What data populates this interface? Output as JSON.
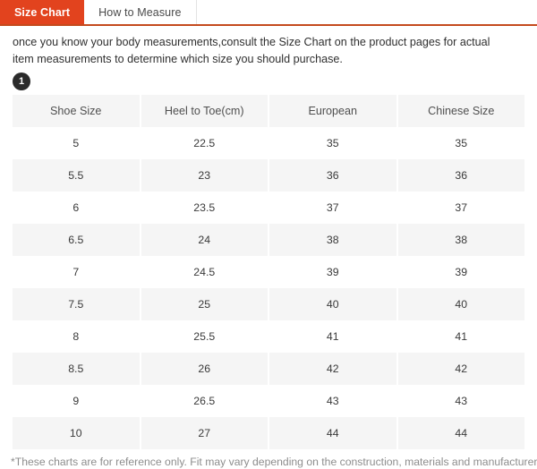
{
  "tabs": [
    {
      "label": "Size Chart",
      "active": true
    },
    {
      "label": "How to Measure",
      "active": false
    }
  ],
  "intro": {
    "text": "once you know your body measurements,consult the Size Chart on the product pages for actual item measurements to determine which size you should purchase.",
    "badge": "1"
  },
  "chart_data": {
    "type": "table",
    "title": "Size Chart",
    "columns": [
      "Shoe Size",
      "Heel to Toe(cm)",
      "European",
      "Chinese Size"
    ],
    "rows": [
      [
        "5",
        "22.5",
        "35",
        "35"
      ],
      [
        "5.5",
        "23",
        "36",
        "36"
      ],
      [
        "6",
        "23.5",
        "37",
        "37"
      ],
      [
        "6.5",
        "24",
        "38",
        "38"
      ],
      [
        "7",
        "24.5",
        "39",
        "39"
      ],
      [
        "7.5",
        "25",
        "40",
        "40"
      ],
      [
        "8",
        "25.5",
        "41",
        "41"
      ],
      [
        "8.5",
        "26",
        "42",
        "42"
      ],
      [
        "9",
        "26.5",
        "43",
        "43"
      ],
      [
        "10",
        "27",
        "44",
        "44"
      ]
    ]
  },
  "footnote": "*These charts are for reference only. Fit may vary depending on the construction, materials and manufacturer.",
  "colors": {
    "accent": "#e2431e",
    "accent_border": "#c44a1e",
    "stripe": "#f5f5f5",
    "badge": "#2b2b2b"
  }
}
